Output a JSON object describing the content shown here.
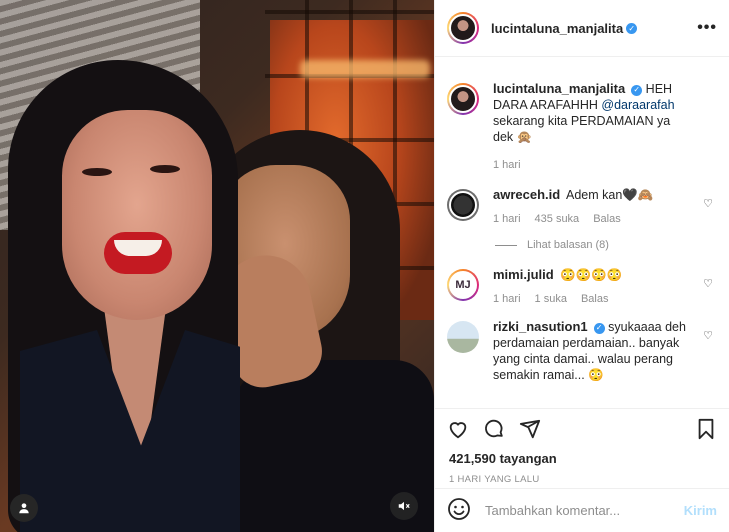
{
  "post": {
    "username": "lucintaluna_manjalita"
  },
  "caption": {
    "username": "lucintaluna_manjalita",
    "text_before": " HEH DARA ARAFAHHH ",
    "mention": "@daraarafah",
    "text_after": " sekarang kita PERDAMAIAN ya dek 🙊 ",
    "time": "1 hari"
  },
  "comments": [
    {
      "username": "awreceh.id",
      "text": "Adem kan🖤🙈",
      "time": "1 hari",
      "likes": "435 suka",
      "reply": "Balas",
      "see_replies": "Lihat balasan (8)"
    },
    {
      "username": "mimi.julid",
      "text": "😳😳😳😳",
      "time": "1 hari",
      "likes": "1 suka",
      "reply": "Balas"
    },
    {
      "username": "rizki_nasution1",
      "text": "syukaaaa deh perdamaian perdamaian.. banyak yang cinta damai.. walau perang semakin ramai... 😳"
    }
  ],
  "stats": {
    "views": "421,590 tayangan",
    "ago": "1 HARI YANG LALU"
  },
  "add_comment": {
    "placeholder": "Tambahkan komentar...",
    "post_label": "Kirim"
  },
  "colors": {
    "verified": "#3897f0",
    "link": "#00376b",
    "muted": "#8e8e8e",
    "post_disabled": "#b2dffc"
  }
}
